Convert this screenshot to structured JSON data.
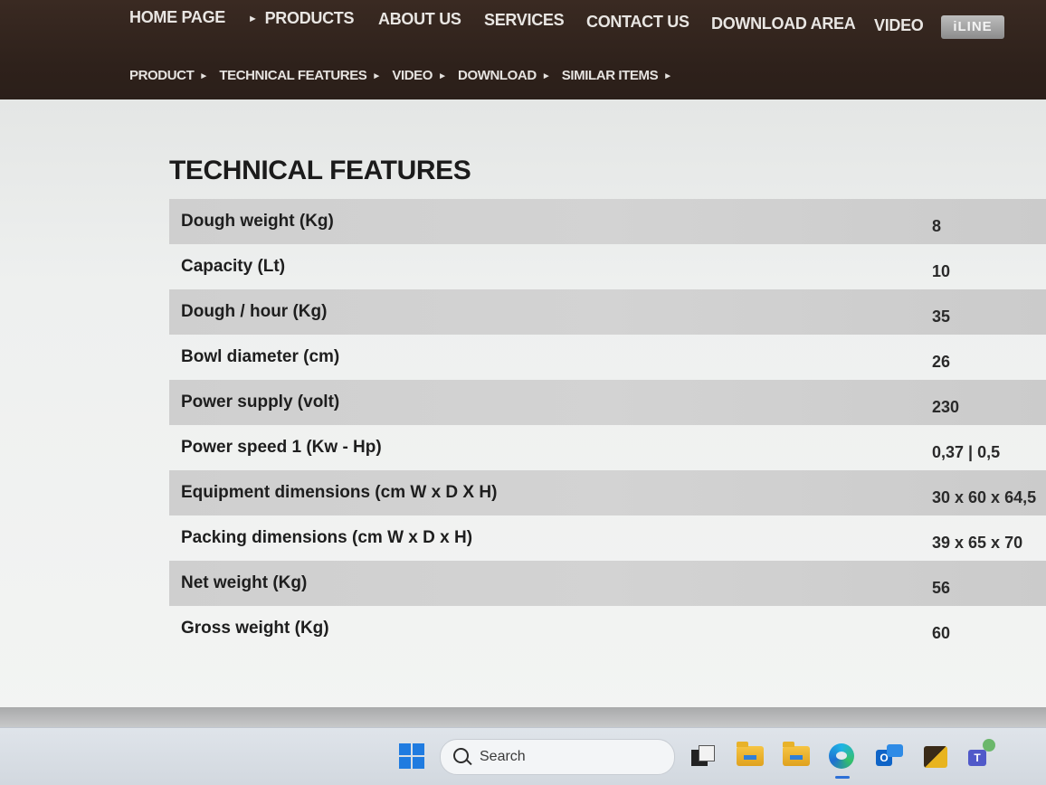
{
  "nav": {
    "main": [
      {
        "label": "HOME PAGE",
        "arrow": ""
      },
      {
        "label": "PRODUCTS",
        "arrow": "►"
      },
      {
        "label": "ABOUT US",
        "arrow": ""
      },
      {
        "label": "SERVICES",
        "arrow": ""
      },
      {
        "label": "CONTACT US",
        "arrow": ""
      },
      {
        "label": "DOWNLOAD AREA",
        "arrow": ""
      },
      {
        "label": "VIDEO",
        "arrow": ""
      }
    ],
    "logo_text": "iLINE",
    "sub": [
      {
        "label": "PRODUCT",
        "arrow": "►"
      },
      {
        "label": "TECHNICAL FEATURES",
        "arrow": "►"
      },
      {
        "label": "VIDEO",
        "arrow": "►"
      },
      {
        "label": "DOWNLOAD",
        "arrow": "►"
      },
      {
        "label": "SIMILAR ITEMS",
        "arrow": "►"
      }
    ]
  },
  "section": {
    "title": "TECHNICAL FEATURES",
    "rows": [
      {
        "label": "Dough weight (Kg)",
        "value": "8"
      },
      {
        "label": "Capacity (Lt)",
        "value": "10"
      },
      {
        "label": "Dough / hour (Kg)",
        "value": "35"
      },
      {
        "label": "Bowl diameter (cm)",
        "value": "26"
      },
      {
        "label": "Power supply (volt)",
        "value": "230"
      },
      {
        "label": "Power speed 1 (Kw - Hp)",
        "value": "0,37 | 0,5"
      },
      {
        "label": "Equipment dimensions (cm W x D X H)",
        "value": "30 x 60 x 64,5"
      },
      {
        "label": "Packing dimensions (cm W x D x H)",
        "value": "39 x 65 x 70"
      },
      {
        "label": "Net weight (Kg)",
        "value": "56"
      },
      {
        "label": "Gross weight (Kg)",
        "value": "60"
      }
    ]
  },
  "taskbar": {
    "search_label": "Search",
    "icons": [
      "windows-start-icon",
      "task-view-icon",
      "file-explorer-icon",
      "folder-icon",
      "edge-browser-icon",
      "outlook-icon",
      "sticky-app-icon",
      "teams-icon"
    ]
  }
}
